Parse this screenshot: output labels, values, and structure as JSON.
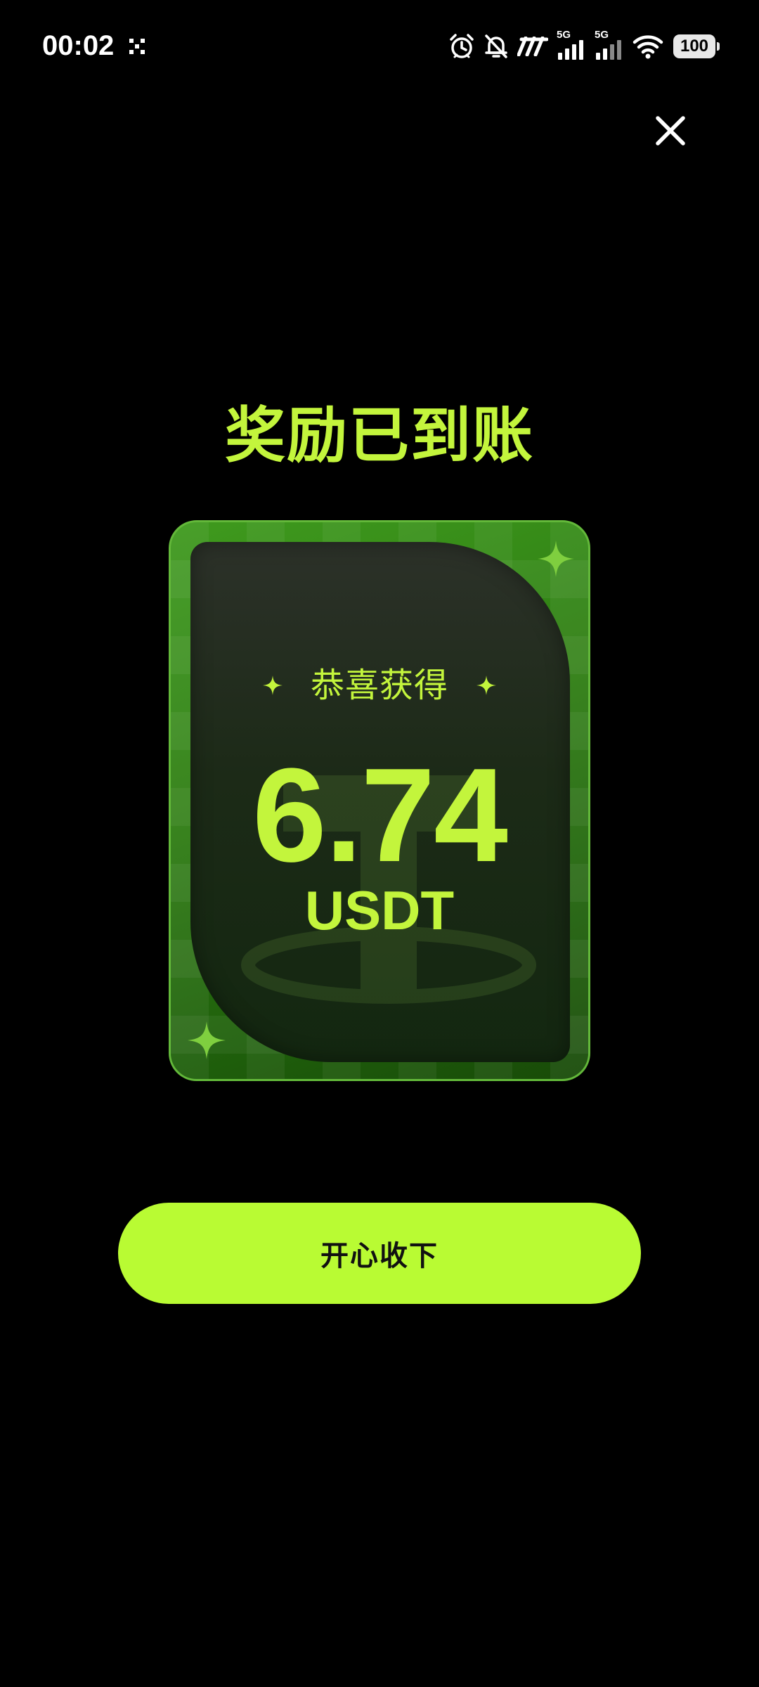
{
  "status_bar": {
    "time": "00:02",
    "network_1": "5G",
    "network_2": "5G",
    "battery": "100"
  },
  "dialog": {
    "title": "奖励已到账",
    "subtitle": "恭喜获得",
    "amount": "6.74",
    "unit": "USDT",
    "accept_label": "开心收下"
  },
  "colors": {
    "accent": "#c3f53c",
    "button": "#b9fb33",
    "card_green": "#2f7f13",
    "background": "#000000"
  },
  "icons": {
    "close": "close-icon",
    "sparkle": "sparkle-icon",
    "alarm": "alarm-icon",
    "mute": "bell-off-icon",
    "wifi": "wifi-icon"
  }
}
